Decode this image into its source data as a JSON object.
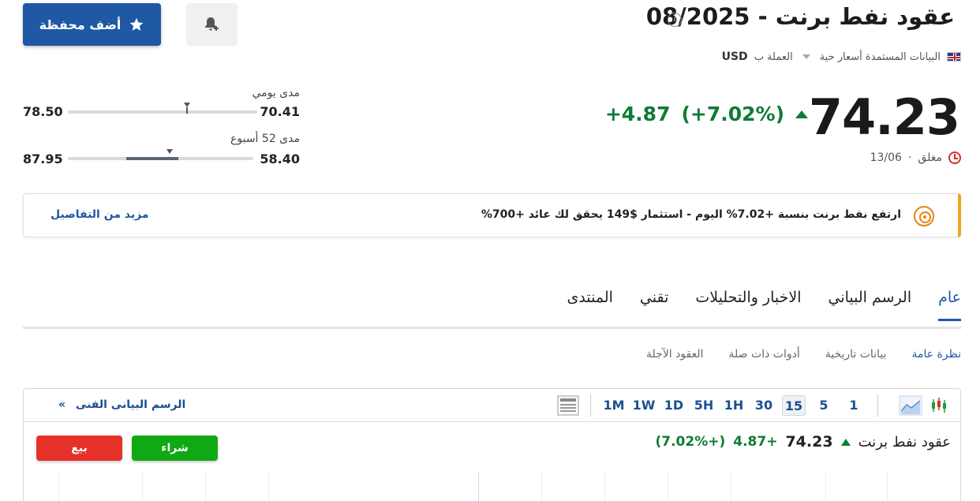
{
  "header": {
    "title": "عقود نفط برنت - 08/2025",
    "info_icon": "info-icon",
    "data_source": "البيانات المستمدة أسعار حية",
    "currency_label": "العملة ب",
    "currency": "USD",
    "add_portfolio": "أضف محفظة",
    "add_alert_icon": "bell-plus-icon"
  },
  "quote": {
    "price": "74.23",
    "change": "+4.87",
    "change_pct": "(+7.02%)",
    "status": "مغلق",
    "separator": "·",
    "date": "13/06",
    "colors": {
      "up": "#0e7c35",
      "brand": "#1f58a5"
    }
  },
  "ranges": {
    "daily": {
      "label": "مدى يومي",
      "low": "70.41",
      "high": "78.50",
      "marker_fraction": 0.63
    },
    "week52": {
      "label": "مدى 52 أسبوع",
      "low": "58.40",
      "high": "87.95",
      "marker_fraction": 0.55
    }
  },
  "banner": {
    "text": "ارتفع نفط برنت بنسبة +7.02% اليوم - استثمار $149 يحقق لك عائد +700%",
    "link": "مزيد من التفاصيل"
  },
  "tabs": [
    "عام",
    "الرسم البياني",
    "الاخبار والتحليلات",
    "تقني",
    "المنتدى"
  ],
  "subtabs": [
    "نظرة عامة",
    "بيانات تاريخية",
    "أدوات ذات صلة",
    "العقود الآجلة"
  ],
  "chart_widget": {
    "intervals": [
      "1",
      "5",
      "15",
      "30",
      "1H",
      "5H",
      "1D",
      "1W",
      "1M"
    ],
    "active_interval": "15",
    "technical_link": "الرسم البيانى الفنى",
    "link_arrow": "»",
    "name": "عقود نفط برنت",
    "price": "74.23",
    "change": "+4.87",
    "change_pct": "(+7.02%)",
    "buy": "شراء",
    "sell": "بيع"
  }
}
